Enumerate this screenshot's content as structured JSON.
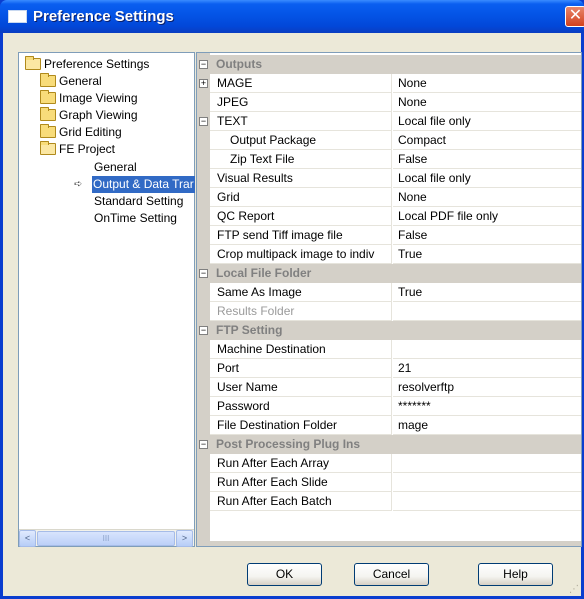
{
  "window": {
    "title": "Preference Settings",
    "close_glyph": "✕"
  },
  "tree": {
    "root": "Preference Settings",
    "items": [
      {
        "label": "General"
      },
      {
        "label": "Image Viewing"
      },
      {
        "label": "Graph Viewing"
      },
      {
        "label": "Grid Editing"
      },
      {
        "label": "FE Project"
      }
    ],
    "fe_children": [
      {
        "label": "General"
      },
      {
        "label": "Output & Data Trar"
      },
      {
        "label": "Standard Setting"
      },
      {
        "label": "OnTime Setting"
      }
    ],
    "selected_marker": "➪",
    "scroll_left": "<",
    "scroll_right": ">",
    "scroll_grip": "III"
  },
  "properties": {
    "outputs": {
      "title": "Outputs",
      "mage": {
        "name": "MAGE",
        "value": "None"
      },
      "jpeg": {
        "name": "JPEG",
        "value": "None"
      },
      "text": {
        "name": "TEXT",
        "value": "Local file only"
      },
      "output_package": {
        "name": "Output Package",
        "value": "Compact"
      },
      "zip_text_file": {
        "name": "Zip Text File",
        "value": "False"
      },
      "visual_results": {
        "name": "Visual Results",
        "value": "Local file only"
      },
      "grid": {
        "name": "Grid",
        "value": "None"
      },
      "qc_report": {
        "name": "QC Report",
        "value": "Local PDF file only"
      },
      "ftp_send_tiff": {
        "name": "FTP send Tiff image file",
        "value": "False"
      },
      "crop_multipack": {
        "name": "Crop multipack image to indiv",
        "value": "True"
      }
    },
    "local_file_folder": {
      "title": "Local File Folder",
      "same_as_image": {
        "name": "Same As Image",
        "value": "True"
      },
      "results_folder": {
        "name": "Results Folder",
        "value": ""
      }
    },
    "ftp_setting": {
      "title": "FTP Setting",
      "machine_destination": {
        "name": "Machine Destination",
        "value": ""
      },
      "port": {
        "name": "Port",
        "value": "21"
      },
      "user_name": {
        "name": "User Name",
        "value": "resolverftp"
      },
      "password": {
        "name": "Password",
        "value": "*******"
      },
      "file_destination_folder": {
        "name": "File Destination Folder",
        "value": "mage"
      }
    },
    "post_processing": {
      "title": "Post Processing Plug Ins",
      "run_after_array": {
        "name": "Run After Each Array",
        "value": ""
      },
      "run_after_slide": {
        "name": "Run After Each Slide",
        "value": ""
      },
      "run_after_batch": {
        "name": "Run After Each Batch",
        "value": ""
      }
    },
    "toggle_collapse": "−",
    "toggle_expand": "+"
  },
  "buttons": {
    "ok": "OK",
    "cancel": "Cancel",
    "help": "Help"
  },
  "colors": {
    "titlebar": "#0454E6",
    "selection": "#316AC5",
    "dialog_bg": "#ECE9D8",
    "category_bg": "#D4D0C8"
  }
}
